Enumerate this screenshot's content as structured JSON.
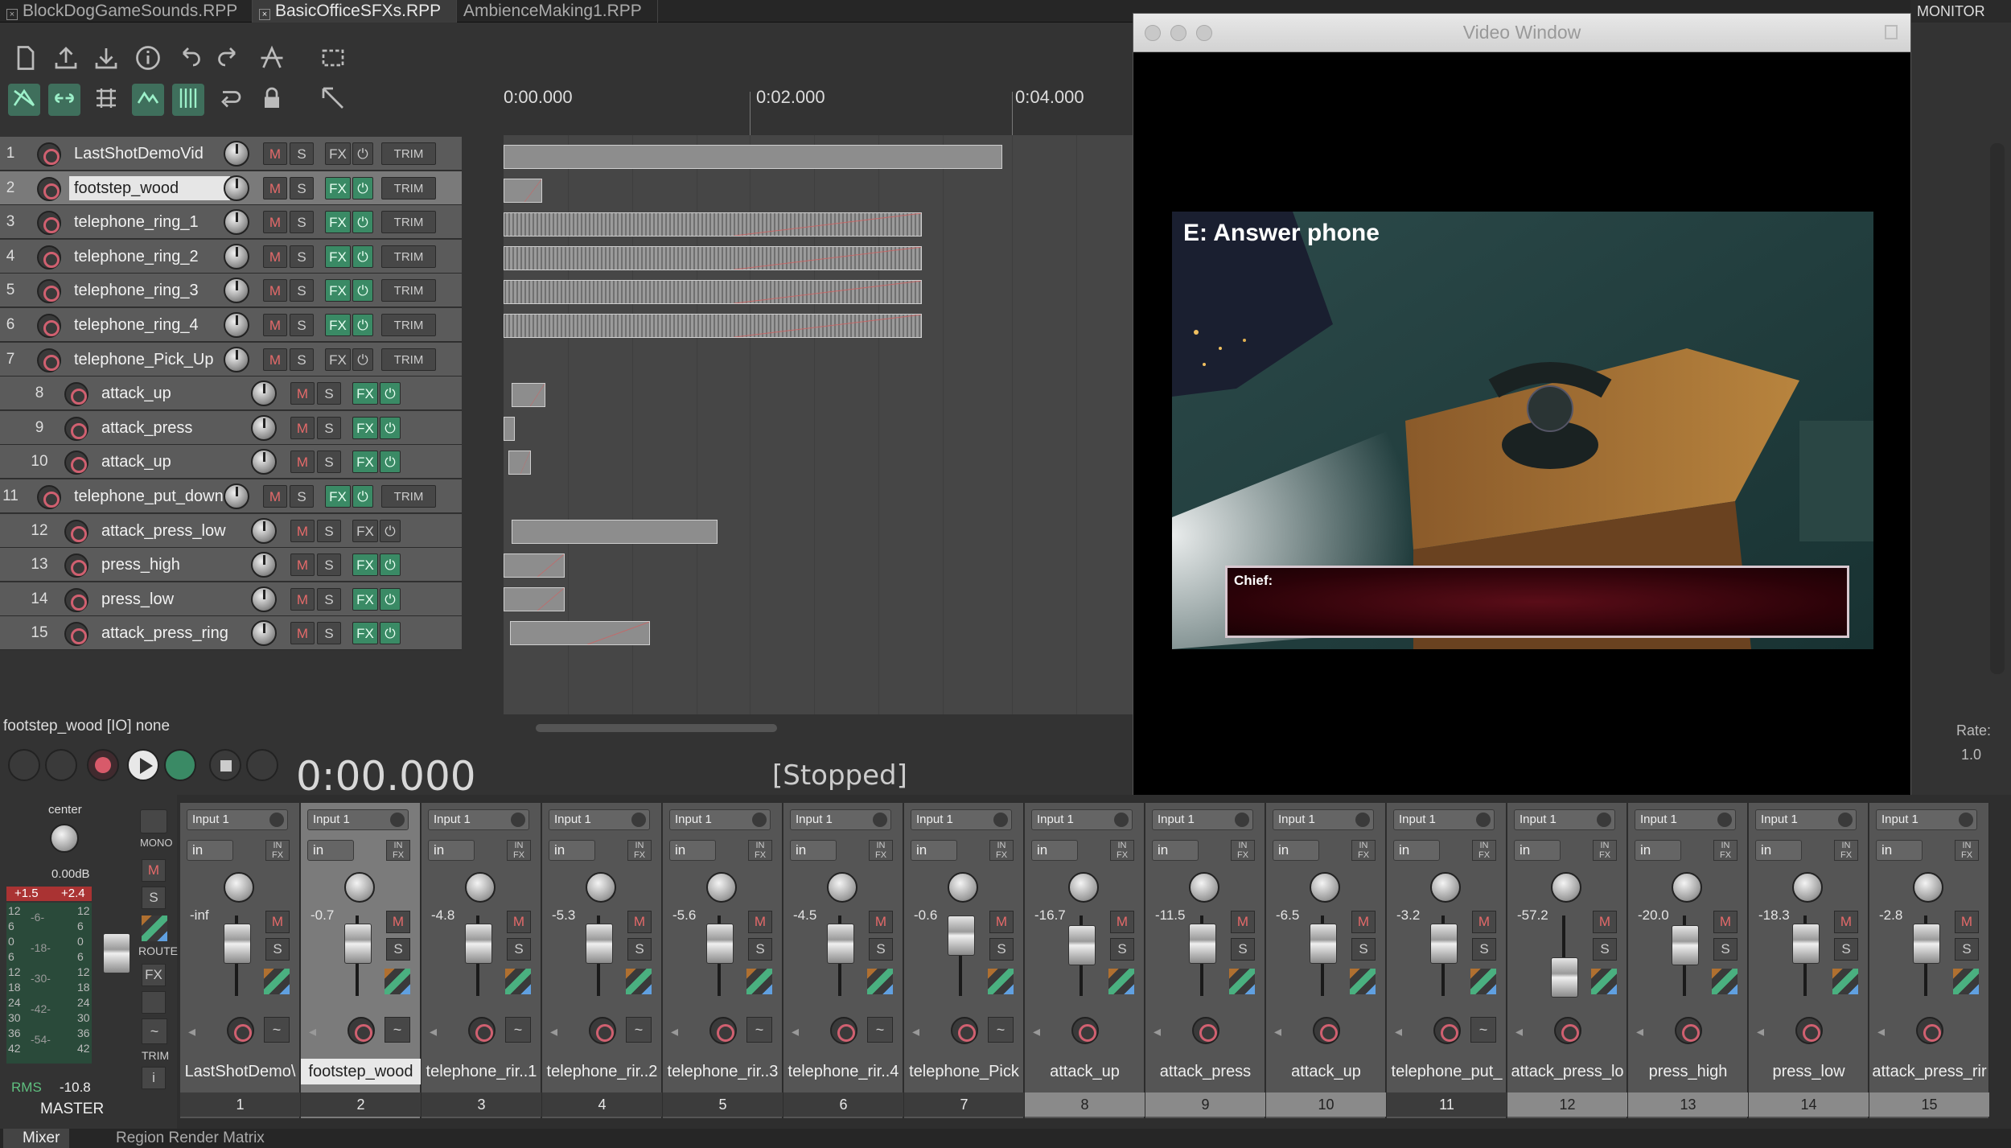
{
  "tabs": [
    {
      "label": "BlockDogGameSounds.RPP",
      "active": false
    },
    {
      "label": "BasicOfficeSFXs.RPP",
      "active": true
    },
    {
      "label": "AmbienceMaking1.RPP",
      "active": false
    }
  ],
  "monitor_fx": "MONITOR FX",
  "ruler": {
    "t0": "0:00.000",
    "t1": "0:02.000",
    "t2": "0:04.000"
  },
  "tracks": [
    {
      "num": "1",
      "name": "LastShotDemoVid",
      "fx_on": false,
      "trim": true,
      "child": false,
      "selected": false
    },
    {
      "num": "2",
      "name": "footstep_wood",
      "fx_on": true,
      "trim": true,
      "child": false,
      "selected": true
    },
    {
      "num": "3",
      "name": "telephone_ring_1",
      "fx_on": true,
      "trim": true,
      "child": false,
      "selected": false
    },
    {
      "num": "4",
      "name": "telephone_ring_2",
      "fx_on": true,
      "trim": true,
      "child": false,
      "selected": false
    },
    {
      "num": "5",
      "name": "telephone_ring_3",
      "fx_on": true,
      "trim": true,
      "child": false,
      "selected": false
    },
    {
      "num": "6",
      "name": "telephone_ring_4",
      "fx_on": true,
      "trim": true,
      "child": false,
      "selected": false
    },
    {
      "num": "7",
      "name": "telephone_Pick_Up",
      "fx_on": false,
      "trim": true,
      "child": false,
      "selected": false
    },
    {
      "num": "8",
      "name": "attack_up",
      "fx_on": true,
      "trim": false,
      "child": true,
      "selected": false
    },
    {
      "num": "9",
      "name": "attack_press",
      "fx_on": true,
      "trim": false,
      "child": true,
      "selected": false
    },
    {
      "num": "10",
      "name": "attack_up",
      "fx_on": true,
      "trim": false,
      "child": true,
      "selected": false
    },
    {
      "num": "11",
      "name": "telephone_put_down",
      "fx_on": true,
      "trim": true,
      "child": false,
      "selected": false
    },
    {
      "num": "12",
      "name": "attack_press_low",
      "fx_on": false,
      "trim": false,
      "child": true,
      "selected": false
    },
    {
      "num": "13",
      "name": "press_high",
      "fx_on": true,
      "trim": false,
      "child": true,
      "selected": false
    },
    {
      "num": "14",
      "name": "press_low",
      "fx_on": true,
      "trim": false,
      "child": true,
      "selected": false
    },
    {
      "num": "15",
      "name": "attack_press_ring",
      "fx_on": true,
      "trim": false,
      "child": true,
      "selected": false
    }
  ],
  "track_buttons": {
    "mute": "M",
    "solo": "S",
    "fx": "FX",
    "trim": "TRIM"
  },
  "status_text": "footstep_wood [IO] none",
  "transport": {
    "time": "0:00.000",
    "state": "[Stopped]",
    "rate_label": "Rate:",
    "rate_value": "1.0"
  },
  "video_window": {
    "title": "Video Window",
    "prompt": "E: Answer phone",
    "dialog_speaker": "Chief:"
  },
  "master": {
    "pan_label": "center",
    "volume": "0.00dB",
    "peak_left": "+1.5",
    "peak_right": "+2.4",
    "rms_label": "RMS",
    "rms_value": "-10.8",
    "name": "MASTER",
    "mono": "MONO",
    "route": "ROUTE",
    "fx": "FX",
    "trim": "TRIM",
    "scale": [
      "12",
      "6",
      "0",
      "6",
      "12",
      "18",
      "24",
      "30",
      "36",
      "42"
    ],
    "scale_neg": [
      "-6-",
      "-18-",
      "-30-",
      "-42-",
      "-54-"
    ]
  },
  "mixer_strips": [
    {
      "num": "1",
      "name": "LastShotDemo\\",
      "db": "-inf",
      "child": false,
      "selected": false,
      "input": "Input 1",
      "in": "in"
    },
    {
      "num": "2",
      "name": "footstep_wood",
      "db": "-0.7",
      "child": false,
      "selected": true,
      "input": "Input 1",
      "in": "in"
    },
    {
      "num": "3",
      "name": "telephone_rir..1",
      "db": "-4.8",
      "child": false,
      "selected": false,
      "input": "Input 1",
      "in": "in"
    },
    {
      "num": "4",
      "name": "telephone_rir..2",
      "db": "-5.3",
      "child": false,
      "selected": false,
      "input": "Input 1",
      "in": "in"
    },
    {
      "num": "5",
      "name": "telephone_rir..3",
      "db": "-5.6",
      "child": false,
      "selected": false,
      "input": "Input 1",
      "in": "in"
    },
    {
      "num": "6",
      "name": "telephone_rir..4",
      "db": "-4.5",
      "child": false,
      "selected": false,
      "input": "Input 1",
      "in": "in"
    },
    {
      "num": "7",
      "name": "telephone_Pick",
      "db": "-0.6",
      "child": false,
      "selected": false,
      "input": "Input 1",
      "in": "in"
    },
    {
      "num": "8",
      "name": "attack_up",
      "db": "-16.7",
      "child": true,
      "selected": false,
      "input": "Input 1",
      "in": "in"
    },
    {
      "num": "9",
      "name": "attack_press",
      "db": "-11.5",
      "child": true,
      "selected": false,
      "input": "Input 1",
      "in": "in"
    },
    {
      "num": "10",
      "name": "attack_up",
      "db": "-6.5",
      "child": true,
      "selected": false,
      "input": "Input 1",
      "in": "in"
    },
    {
      "num": "11",
      "name": "telephone_put_",
      "db": "-3.2",
      "child": false,
      "selected": false,
      "input": "Input 1",
      "in": "in"
    },
    {
      "num": "12",
      "name": "attack_press_lo",
      "db": "-57.2",
      "child": true,
      "selected": false,
      "input": "Input 1",
      "in": "in"
    },
    {
      "num": "13",
      "name": "press_high",
      "db": "-20.0",
      "child": true,
      "selected": false,
      "input": "Input 1",
      "in": "in"
    },
    {
      "num": "14",
      "name": "press_low",
      "db": "-18.3",
      "child": true,
      "selected": false,
      "input": "Input 1",
      "in": "in"
    },
    {
      "num": "15",
      "name": "attack_press_rir",
      "db": "-2.8",
      "child": true,
      "selected": false,
      "input": "Input 1",
      "in": "in"
    }
  ],
  "bottom_tabs": [
    "Mixer",
    "Region Render Matrix"
  ]
}
